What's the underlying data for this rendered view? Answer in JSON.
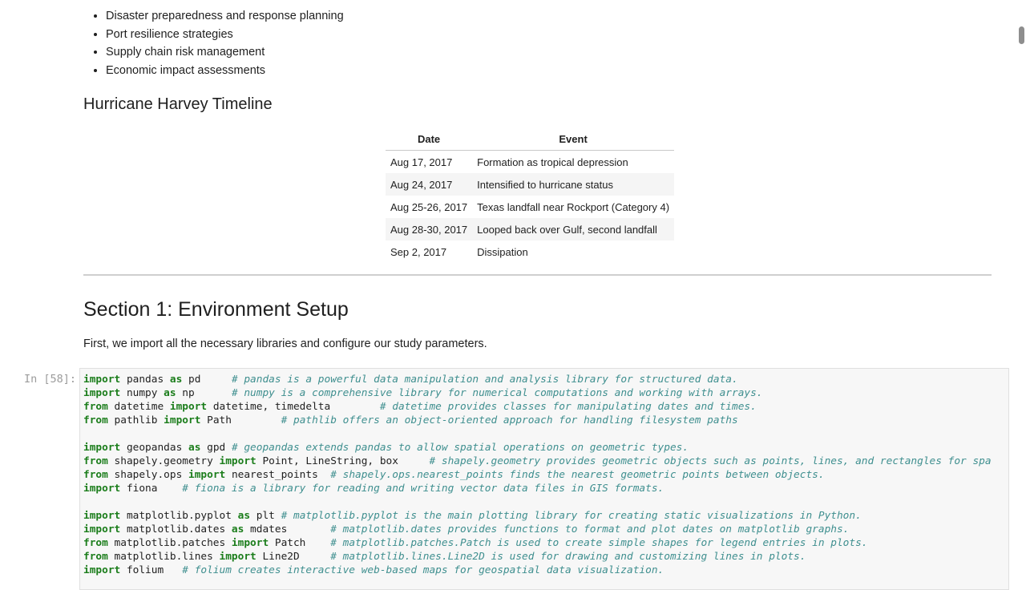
{
  "bullets": [
    "Disaster preparedness and response planning",
    "Port resilience strategies",
    "Supply chain risk management",
    "Economic impact assessments"
  ],
  "timeline": {
    "title": "Hurricane Harvey Timeline",
    "headers": [
      "Date",
      "Event"
    ],
    "rows": [
      [
        "Aug 17, 2017",
        "Formation as tropical depression"
      ],
      [
        "Aug 24, 2017",
        "Intensified to hurricane status"
      ],
      [
        "Aug 25-26, 2017",
        "Texas landfall near Rockport (Category 4)"
      ],
      [
        "Aug 28-30, 2017",
        "Looped back over Gulf, second landfall"
      ],
      [
        "Sep 2, 2017",
        "Dissipation"
      ]
    ]
  },
  "section": {
    "title": "Section 1: Environment Setup",
    "intro": "First, we import all the necessary libraries and configure our study parameters."
  },
  "cell": {
    "prompt": "In [58]:",
    "lines": [
      [
        [
          "kw",
          "import"
        ],
        [
          "id",
          " pandas "
        ],
        [
          "kw",
          "as"
        ],
        [
          "id",
          " pd     "
        ],
        [
          "cm",
          "# pandas is a powerful data manipulation and analysis library for structured data."
        ]
      ],
      [
        [
          "kw",
          "import"
        ],
        [
          "id",
          " numpy "
        ],
        [
          "kw",
          "as"
        ],
        [
          "id",
          " np      "
        ],
        [
          "cm",
          "# numpy is a comprehensive library for numerical computations and working with arrays."
        ]
      ],
      [
        [
          "kw",
          "from"
        ],
        [
          "id",
          " datetime "
        ],
        [
          "kw",
          "import"
        ],
        [
          "id",
          " datetime, timedelta        "
        ],
        [
          "cm",
          "# datetime provides classes for manipulating dates and times."
        ]
      ],
      [
        [
          "kw",
          "from"
        ],
        [
          "id",
          " pathlib "
        ],
        [
          "kw",
          "import"
        ],
        [
          "id",
          " Path        "
        ],
        [
          "cm",
          "# pathlib offers an object-oriented approach for handling filesystem paths"
        ]
      ],
      [],
      [
        [
          "kw",
          "import"
        ],
        [
          "id",
          " geopandas "
        ],
        [
          "kw",
          "as"
        ],
        [
          "id",
          " gpd "
        ],
        [
          "cm",
          "# geopandas extends pandas to allow spatial operations on geometric types."
        ]
      ],
      [
        [
          "kw",
          "from"
        ],
        [
          "id",
          " shapely.geometry "
        ],
        [
          "kw",
          "import"
        ],
        [
          "id",
          " Point, LineString, box     "
        ],
        [
          "cm",
          "# shapely.geometry provides geometric objects such as points, lines, and rectangles for spa"
        ]
      ],
      [
        [
          "kw",
          "from"
        ],
        [
          "id",
          " shapely.ops "
        ],
        [
          "kw",
          "import"
        ],
        [
          "id",
          " nearest_points  "
        ],
        [
          "cm",
          "# shapely.ops.nearest_points finds the nearest geometric points between objects."
        ]
      ],
      [
        [
          "kw",
          "import"
        ],
        [
          "id",
          " fiona    "
        ],
        [
          "cm",
          "# fiona is a library for reading and writing vector data files in GIS formats."
        ]
      ],
      [],
      [
        [
          "kw",
          "import"
        ],
        [
          "id",
          " matplotlib.pyplot "
        ],
        [
          "kw",
          "as"
        ],
        [
          "id",
          " plt "
        ],
        [
          "cm",
          "# matplotlib.pyplot is the main plotting library for creating static visualizations in Python."
        ]
      ],
      [
        [
          "kw",
          "import"
        ],
        [
          "id",
          " matplotlib.dates "
        ],
        [
          "kw",
          "as"
        ],
        [
          "id",
          " mdates       "
        ],
        [
          "cm",
          "# matplotlib.dates provides functions to format and plot dates on matplotlib graphs."
        ]
      ],
      [
        [
          "kw",
          "from"
        ],
        [
          "id",
          " matplotlib.patches "
        ],
        [
          "kw",
          "import"
        ],
        [
          "id",
          " Patch    "
        ],
        [
          "cm",
          "# matplotlib.patches.Patch is used to create simple shapes for legend entries in plots."
        ]
      ],
      [
        [
          "kw",
          "from"
        ],
        [
          "id",
          " matplotlib.lines "
        ],
        [
          "kw",
          "import"
        ],
        [
          "id",
          " Line2D     "
        ],
        [
          "cm",
          "# matplotlib.lines.Line2D is used for drawing and customizing lines in plots."
        ]
      ],
      [
        [
          "kw",
          "import"
        ],
        [
          "id",
          " folium   "
        ],
        [
          "cm",
          "# folium creates interactive web-based maps for geospatial data visualization."
        ]
      ]
    ]
  },
  "colors": {
    "keyword": "#1b7d1b",
    "comment": "#3f8f8f",
    "cell_bg": "#f7f7f7"
  }
}
